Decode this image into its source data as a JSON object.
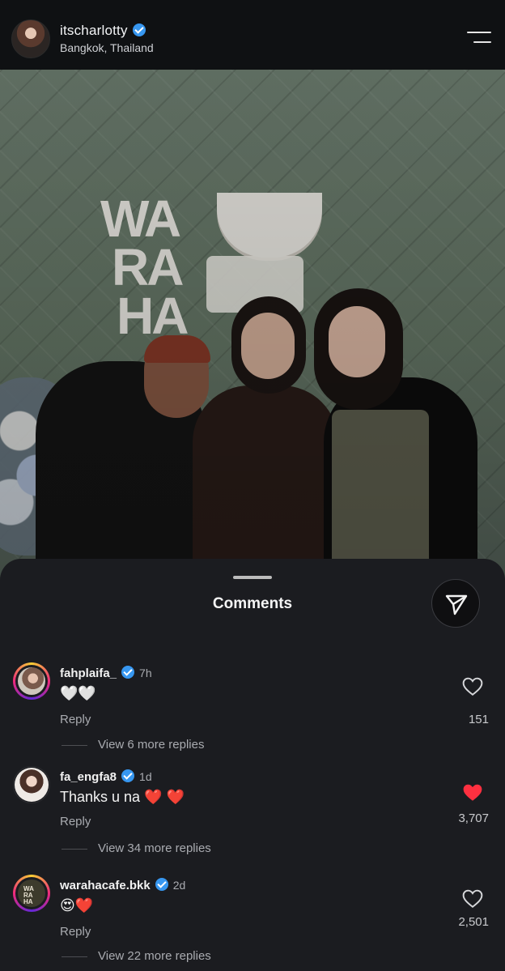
{
  "header": {
    "username": "itscharlotty",
    "location": "Bangkok, Thailand"
  },
  "photo": {
    "sign_lines": [
      "WA",
      "RA",
      "HA"
    ]
  },
  "sheet": {
    "title": "Comments"
  },
  "comments": [
    {
      "username": "fahplaifa_",
      "verified": true,
      "time": "7h",
      "text": "🤍🤍",
      "reply_label": "Reply",
      "likes": "151",
      "liked": false,
      "more_replies": "View 6 more replies"
    },
    {
      "username": "fa_engfa8",
      "verified": true,
      "time": "1d",
      "text": "Thanks u na ❤️ ❤️",
      "reply_label": "Reply",
      "likes": "3,707",
      "liked": true,
      "more_replies": "View 34 more replies"
    },
    {
      "username": "warahacafe.bkk",
      "verified": true,
      "time": "2d",
      "text": "😍❤️",
      "reply_label": "Reply",
      "likes": "2,501",
      "liked": false,
      "more_replies": "View 22 more replies"
    }
  ],
  "colors": {
    "verified_blue": "#3797f0",
    "like_red": "#ff3040",
    "sheet_bg": "#1b1c20"
  }
}
